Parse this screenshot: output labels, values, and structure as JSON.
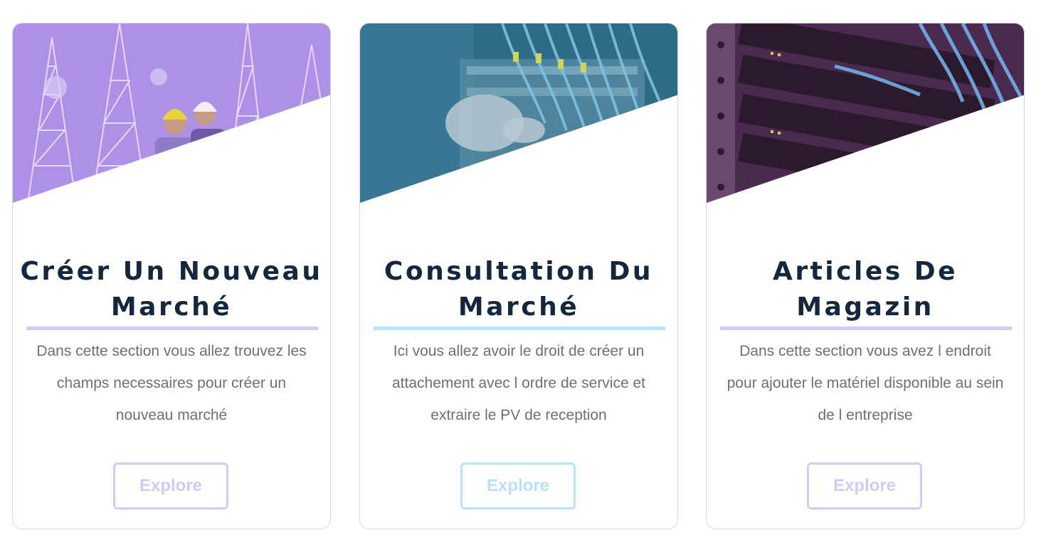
{
  "cards": [
    {
      "title": "Créer Un Nouveau Marché",
      "description": "Dans cette section vous allez trouvez les champs necessaires pour créer un nouveau marché",
      "button_label": "Explore",
      "image_subject": "telecom towers with engineers in hard hats",
      "accent_color": "#cfccf4",
      "image_tint": "#9b6fd6"
    },
    {
      "title": "Consultation Du Marché",
      "description": "Ici vous allez avoir le droit de créer un attachement avec l ordre de service et extraire le PV de reception",
      "button_label": "Explore",
      "image_subject": "technician plugging network cables",
      "accent_color": "#b7e2f5",
      "image_tint": "#2f6f8f"
    },
    {
      "title": "Articles De Magazin",
      "description": "Dans cette section vous avez l endroit pour ajouter le matériel disponible au sein de l entreprise",
      "button_label": "Explore",
      "image_subject": "server rack patch panel with blue cables",
      "accent_color": "#cfccf4",
      "image_tint": "#5a2f5a"
    }
  ]
}
